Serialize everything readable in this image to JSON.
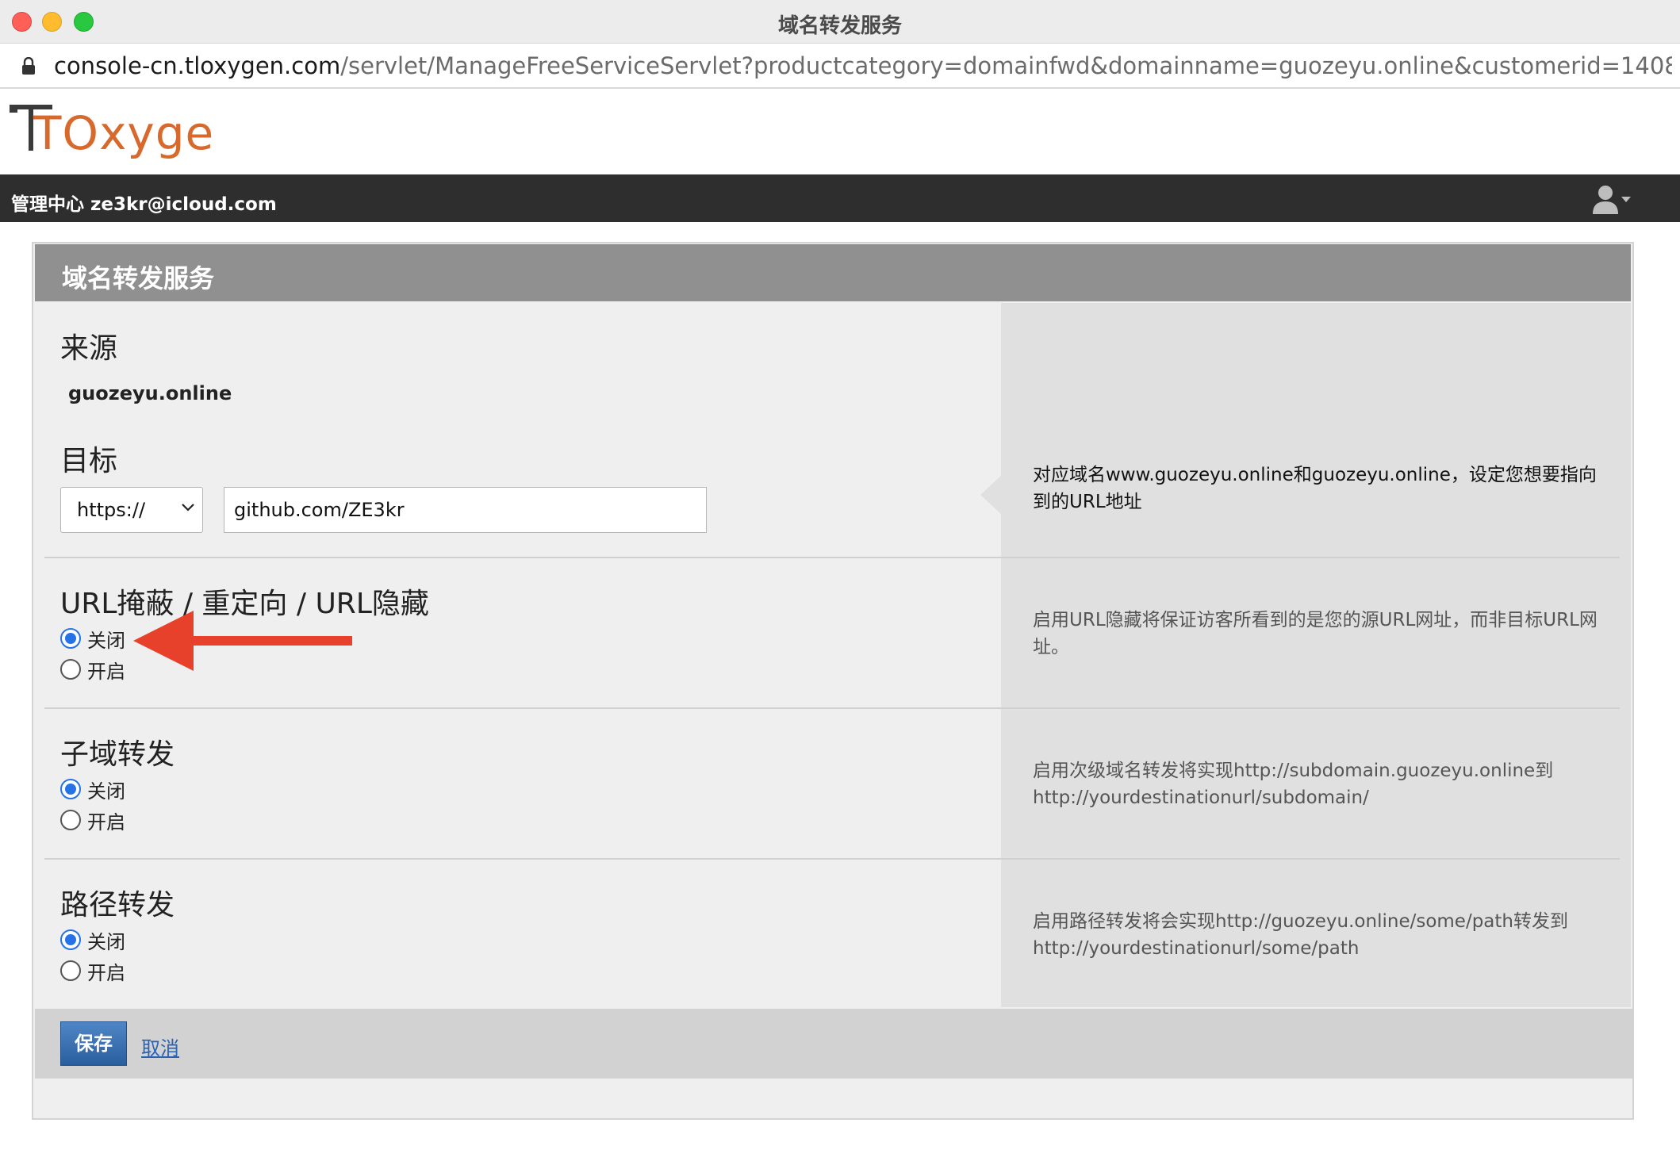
{
  "window": {
    "title": "域名转发服务",
    "url_host": "console-cn.tloxygen.com",
    "url_path": "/servlet/ManageFreeServiceServlet?productcategory=domainfwd&domainname=guozeyu.online&customerid=14087865&rese..."
  },
  "logo": {
    "text": "TOxygen",
    "color": "#d8692d"
  },
  "navbar": {
    "label": "管理中心 ze3kr@icloud.com"
  },
  "panel": {
    "title": "域名转发服务",
    "source": {
      "title": "来源",
      "domain": "guozeyu.online"
    },
    "target": {
      "title": "目标",
      "protocol": "https://",
      "url": "github.com/ZE3kr",
      "help": "对应域名www.guozeyu.online和guozeyu.online，设定您想要指向到的URL地址"
    },
    "masking": {
      "title": "URL掩蔽 / 重定向 / URL隐藏",
      "off_label": "关闭",
      "on_label": "开启",
      "selected": "off",
      "help": "启用URL隐藏将保证访客所看到的是您的源URL网址，而非目标URL网址。"
    },
    "subdomain": {
      "title": "子域转发",
      "off_label": "关闭",
      "on_label": "开启",
      "selected": "off",
      "help": "启用次级域名转发将实现http://subdomain.guozeyu.online到http://yourdestinationurl/subdomain/"
    },
    "path": {
      "title": "路径转发",
      "off_label": "关闭",
      "on_label": "开启",
      "selected": "off",
      "help": "启用路径转发将会实现http://guozeyu.online/some/path转发到http://yourdestinationurl/some/path"
    },
    "actions": {
      "save": "保存",
      "cancel": "取消"
    }
  },
  "colors": {
    "accent": "#2573e6",
    "arrow": "#e8412b",
    "header": "#909090"
  }
}
